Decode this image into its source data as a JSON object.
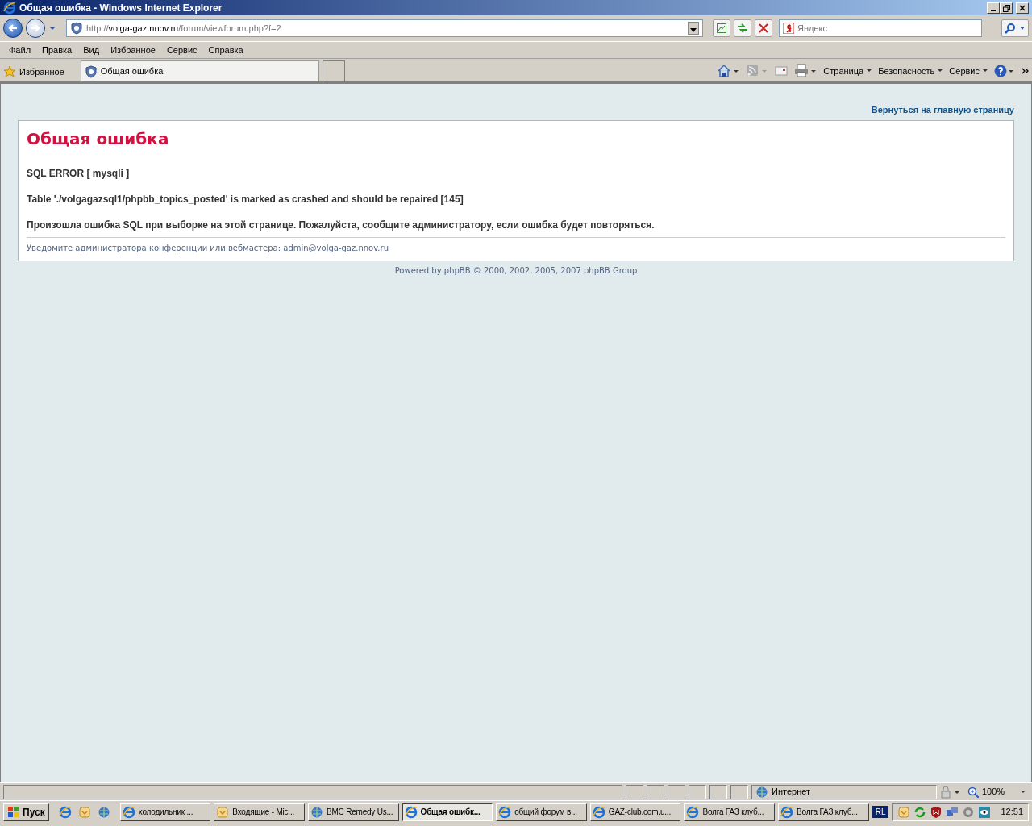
{
  "window": {
    "title": "Общая ошибка - Windows Internet Explorer"
  },
  "address_bar": {
    "scheme": "http://",
    "host": "volga-gaz.nnov.ru",
    "path": "/forum/viewforum.php?f=2"
  },
  "search": {
    "placeholder": "Яндекс"
  },
  "menu": [
    "Файл",
    "Правка",
    "Вид",
    "Избранное",
    "Сервис",
    "Справка"
  ],
  "favorites": "Избранное",
  "tabs": [
    {
      "label": "Общая ошибка",
      "selected": true
    }
  ],
  "command_bar": [
    "Страница",
    "Безопасность",
    "Сервис"
  ],
  "page": {
    "back_link": "Вернуться на главную страницу",
    "heading": "Общая ошибка",
    "sql_error": "SQL ERROR [ mysqli ]",
    "detail": "Table './volgagazsql1/phpbb_topics_posted' is marked as crashed and should be repaired [145]",
    "message_before": "Произошла ошибка SQL при выборке на этой странице. Пожалуйста, сообщите ",
    "message_link": "администратору",
    "message_after": ", если ошибка будет повторяться.",
    "notify_text": "Уведомите администратора конференции или вебмастера: ",
    "notify_email": "admin@volga-gaz.nnov.ru",
    "powered_text": "Powered by phpBB © 2000, 2002, 2005, 2007 ",
    "powered_link": "phpBB Group"
  },
  "status_bar": {
    "zone": "Интернет",
    "zoom": "100%"
  },
  "taskbar": {
    "start": "Пуск",
    "tasks": [
      {
        "label": "холодильник ...",
        "kind": "browser",
        "selected": false
      },
      {
        "label": "Входящие - Mic...",
        "kind": "mail",
        "selected": false
      },
      {
        "label": "BMC Remedy Us...",
        "kind": "app",
        "selected": false
      },
      {
        "label": "Общая ошибк...",
        "kind": "browser",
        "selected": true
      },
      {
        "label": "общий форум в...",
        "kind": "browser",
        "selected": false
      },
      {
        "label": "GAZ-club.com.u...",
        "kind": "browser",
        "selected": false
      },
      {
        "label": "Волга ГАЗ клуб...",
        "kind": "browser",
        "selected": false
      },
      {
        "label": "Волга ГАЗ клуб...",
        "kind": "browser",
        "selected": false
      }
    ],
    "language": "RL",
    "clock": "12:51"
  }
}
